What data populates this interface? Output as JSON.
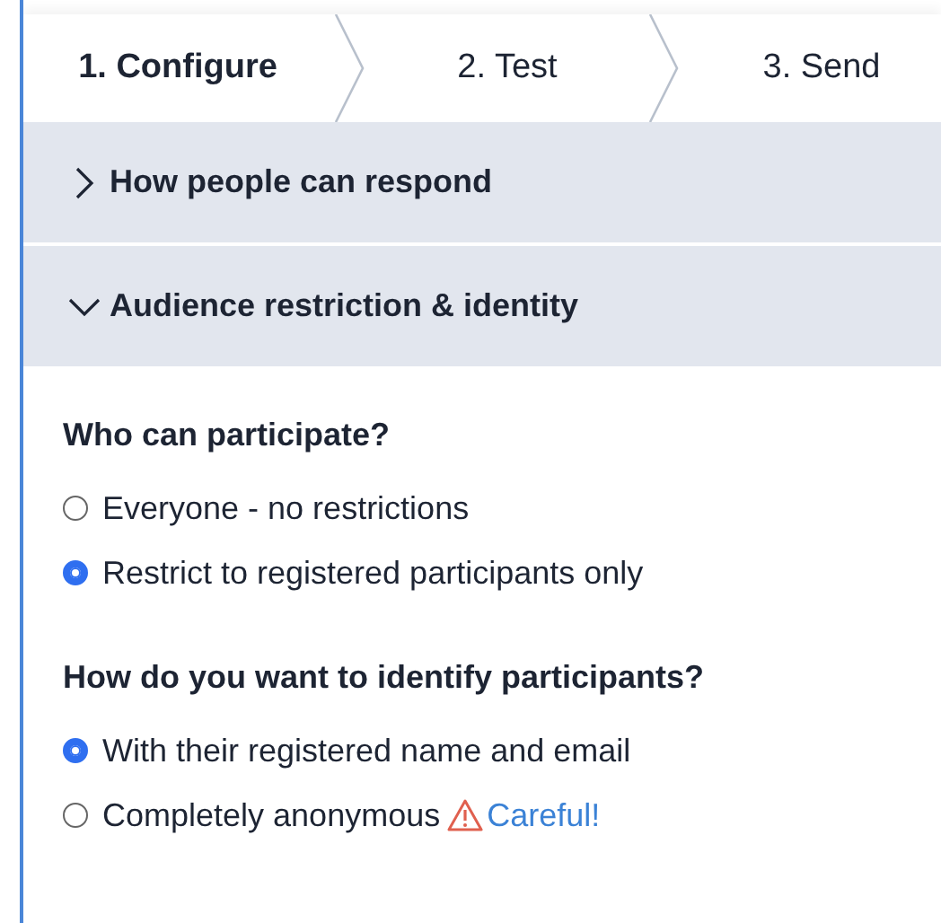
{
  "steps": [
    {
      "label": "1. Configure",
      "selected": true
    },
    {
      "label": "2. Test",
      "selected": false
    },
    {
      "label": "3. Send",
      "selected": false
    }
  ],
  "sections": [
    {
      "title": "How people can respond",
      "expanded": false
    },
    {
      "title": "Audience restriction & identity",
      "expanded": true
    }
  ],
  "questions": [
    {
      "title": "Who can participate?",
      "options": [
        {
          "label": "Everyone - no restrictions",
          "selected": false
        },
        {
          "label": "Restrict to registered participants only",
          "selected": true
        }
      ]
    },
    {
      "title": "How do you want to identify participants?",
      "options": [
        {
          "label": "With their registered name and email",
          "selected": true
        },
        {
          "label": "Completely anonymous",
          "selected": false,
          "warning": "Careful!"
        }
      ]
    }
  ]
}
